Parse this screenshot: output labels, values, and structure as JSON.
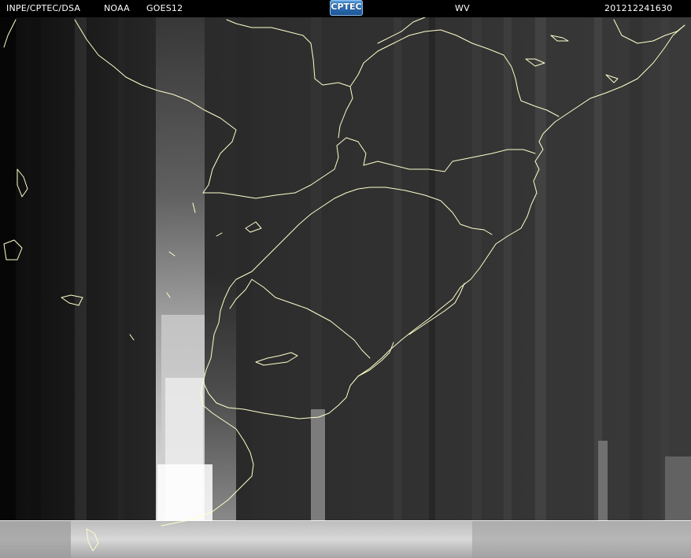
{
  "header": {
    "organization": "INPE/CPTEC/DSA",
    "agency": "NOAA",
    "satellite": "GOES12",
    "channel": "WV",
    "datetime": "201212241630"
  },
  "logo": {
    "text": "CPTEC",
    "colors": {
      "primary": "#2a6fb6",
      "highlight": "#5fa7e6"
    }
  },
  "colors": {
    "coastline": "#ffffcc",
    "boundary": "#ffffff",
    "background": "#1a1a1a"
  }
}
